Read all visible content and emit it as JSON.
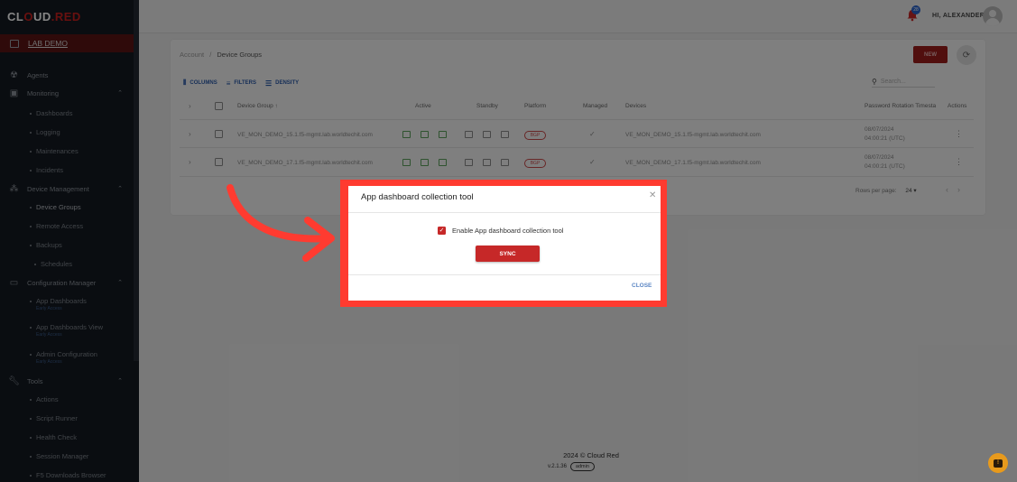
{
  "brand": {
    "part1": "CL",
    "mark": "O",
    "part2": "UD",
    "part3": ".RED"
  },
  "lab": {
    "label": "LAB DEMO"
  },
  "sidebar": {
    "agents": "Agents",
    "monitoring": "Monitoring",
    "dashboards": "Dashboards",
    "logging": "Logging",
    "maintenances": "Maintenances",
    "incidents": "Incidents",
    "device_management": "Device Management",
    "device_groups": "Device Groups",
    "remote_access": "Remote Access",
    "backups": "Backups",
    "schedules": "Schedules",
    "configuration_manager": "Configuration Manager",
    "app_dashboards": "App Dashboards",
    "app_dashboards_beta": "Early Access",
    "app_dashboards_view": "App Dashboards View",
    "app_dashboards_view_beta": "Early Access",
    "admin_configuration": "Admin Configuration",
    "admin_configuration_beta": "Early Access",
    "tools": "Tools",
    "actions": "Actions",
    "script_runner": "Script Runner",
    "health_check": "Health Check",
    "session_manager": "Session Manager",
    "f5_downloads": "F5 Downloads Browser"
  },
  "topbar": {
    "notifications_count": "28",
    "greeting": "HI, ALEXANDER"
  },
  "breadcrumb": {
    "root": "Account",
    "sep": "/",
    "current": "Device Groups"
  },
  "buttons": {
    "new": "NEW"
  },
  "toolbar": {
    "columns": "COLUMNS",
    "filters": "FILTERS",
    "density": "DENSITY",
    "search_placeholder": "Search..."
  },
  "table": {
    "headers": {
      "device_group": "Device Group ↑",
      "active": "Active",
      "standby": "Standby",
      "platform": "Platform",
      "managed": "Managed",
      "devices": "Devices",
      "password_rotation": "Password Rotation Timesta",
      "actions": "Actions"
    },
    "rows": [
      {
        "group": "VE_MON_DEMO_15.1.f5-mgmt.lab.worldtechit.com",
        "platform": "BGP",
        "managed": "✓",
        "devices": "VE_MON_DEMO_15.1.f5-mgmt.lab.worldtechit.com",
        "date": "08/07/2024",
        "time": "04:00:21 (UTC)"
      },
      {
        "group": "VE_MON_DEMO_17.1.f5-mgmt.lab.worldtechit.com",
        "platform": "BGP",
        "managed": "✓",
        "devices": "VE_MON_DEMO_17.1.f5-mgmt.lab.worldtechit.com",
        "date": "08/07/2024",
        "time": "04:00:21 (UTC)"
      }
    ],
    "rows_per_page_label": "Rows per page:",
    "rows_per_page_value": "24 ▾"
  },
  "modal": {
    "title": "App dashboard collection tool",
    "checkbox_label": "Enable App dashboard collection tool",
    "sync": "SYNC",
    "close": "CLOSE"
  },
  "footer": {
    "copyright": "2024 © Cloud Red",
    "version": "v.2.1.36",
    "role": "admin"
  },
  "colors": {
    "accent": "#c62828",
    "highlight_frame": "#ff3b30",
    "sidebar_bg": "#141a22"
  }
}
